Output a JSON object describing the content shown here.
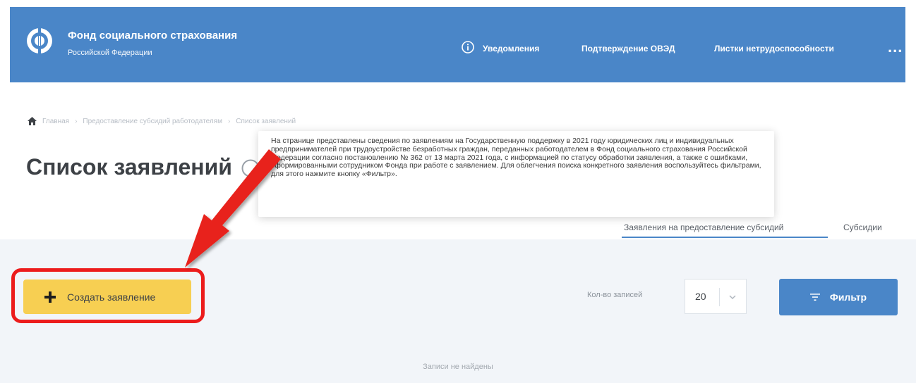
{
  "header": {
    "org_title": "Фонд социального страхования",
    "org_subtitle": "Российской Федерации",
    "nav": {
      "notifications": "Уведомления",
      "oved_confirmation": "Подтверждение ОВЭД",
      "sick_leave": "Листки нетрудоспособности",
      "more": "..."
    }
  },
  "breadcrumb": {
    "home": "Главная",
    "section": "Предоставление субсидий работодателям",
    "current": "Список заявлений",
    "separator": "›"
  },
  "page_title": "Список заявлений",
  "tooltip_text": "На странице представлены сведения по заявлениям на Государственную поддержку в 2021 году юридических лиц и индивидуальных предпринимателей при трудоустройстве безработных граждан, переданных работодателем в Фонд социального страхования Российской Федерации согласно постановлению № 362 от 13 марта 2021 года, с информацией по статусу обработки заявления, а также с ошибками, сформированными сотрудником Фонда при работе с заявлением. Для облегчения поиска конкретного заявления воспользуйтесь фильтрами, для этого нажмите кнопку «Фильтр».",
  "tabs": {
    "applications": "Заявления на предоставление субсидий",
    "subsidies": "Субсидии"
  },
  "toolbar": {
    "create_label": "Создать заявление",
    "records_label": "Кол-во записей",
    "records_value": "20",
    "filter_label": "Фильтр"
  },
  "empty_state": "Записи не найдены",
  "colors": {
    "header_blue": "#4a86c8",
    "create_yellow": "#f7cf52",
    "highlight_red": "#ec1c1c",
    "panel_bg": "#f2f5f9"
  },
  "icons": {
    "logo": "fss-logo-icon",
    "info": "info-icon",
    "home": "home-icon",
    "help": "help-icon",
    "plus": "plus-icon",
    "chevron": "chevron-down-icon",
    "filter": "filter-icon",
    "arrow": "annotation-arrow"
  }
}
